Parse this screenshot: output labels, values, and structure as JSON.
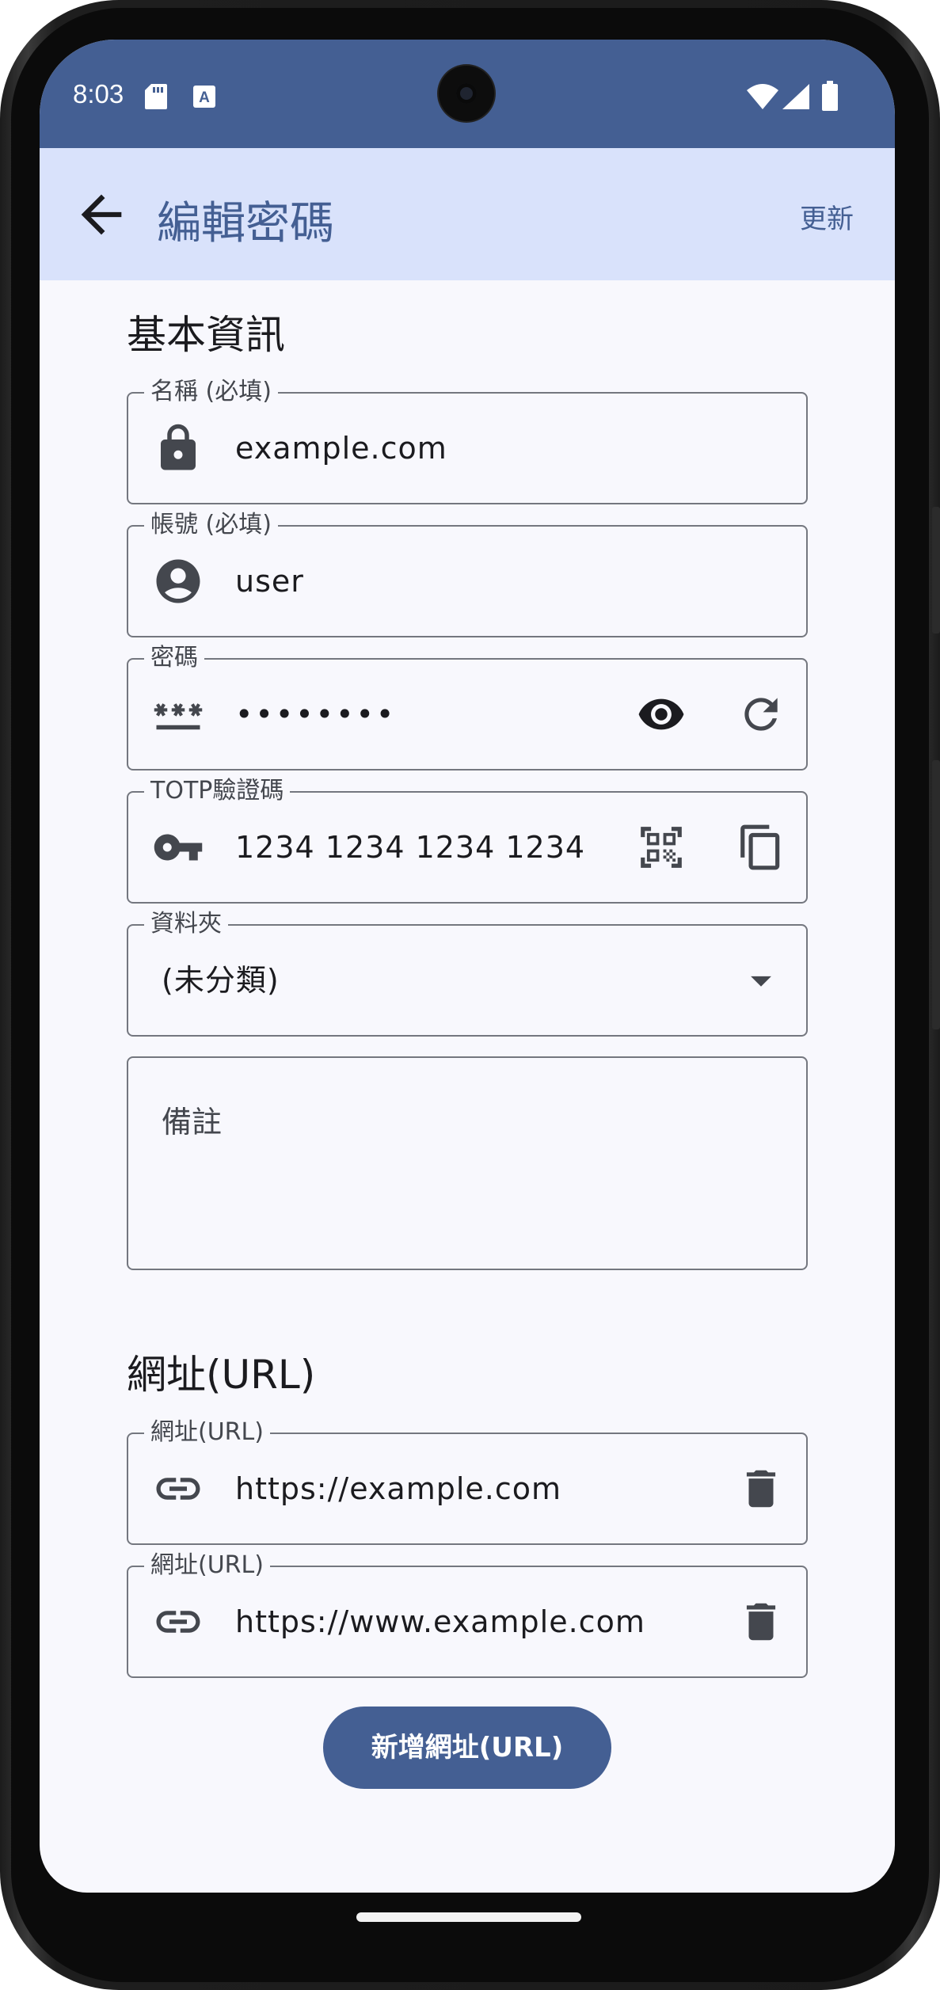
{
  "status_bar": {
    "time": "8:03",
    "icons": [
      "sd-card-icon",
      "keyboard-a-icon",
      "wifi-icon",
      "cellular-signal-icon",
      "battery-icon"
    ]
  },
  "app_bar": {
    "title": "編輯密碼",
    "back_icon": "arrow-back-icon",
    "action_label": "更新"
  },
  "basic_section": {
    "title": "基本資訊",
    "fields": [
      {
        "label": "名稱 (必填)",
        "value": "example.com",
        "icon": "lock-icon"
      },
      {
        "label": "帳號 (必填)",
        "value": "user",
        "icon": "account-circle-icon"
      },
      {
        "label": "密碼",
        "value": "••••••••",
        "icon": "password-icon",
        "actions": [
          "visibility-icon",
          "refresh-icon"
        ]
      },
      {
        "label": "TOTP驗證碼",
        "value": "1234 1234 1234 1234",
        "icon": "key-icon",
        "actions": [
          "qr-code-scanner-icon",
          "copy-icon"
        ]
      },
      {
        "label": "資料夾",
        "value": "(未分類)",
        "actions": [
          "dropdown-arrow-icon"
        ]
      }
    ],
    "note_placeholder": "備註"
  },
  "url_section": {
    "title": "網址(URL)",
    "urls": [
      {
        "label": "網址(URL)",
        "value": "https://example.com",
        "icon": "link-icon",
        "action": "delete-icon"
      },
      {
        "label": "網址(URL)",
        "value": "https://www.example.com",
        "icon": "link-icon",
        "action": "delete-icon"
      }
    ],
    "add_button_label": "新增網址(URL)"
  },
  "colors": {
    "primary": "#445f93",
    "app_bar_bg": "#d9e2fb",
    "surface": "#f8f8fd",
    "outline": "#74777f",
    "on_surface": "#1b1b1f"
  }
}
